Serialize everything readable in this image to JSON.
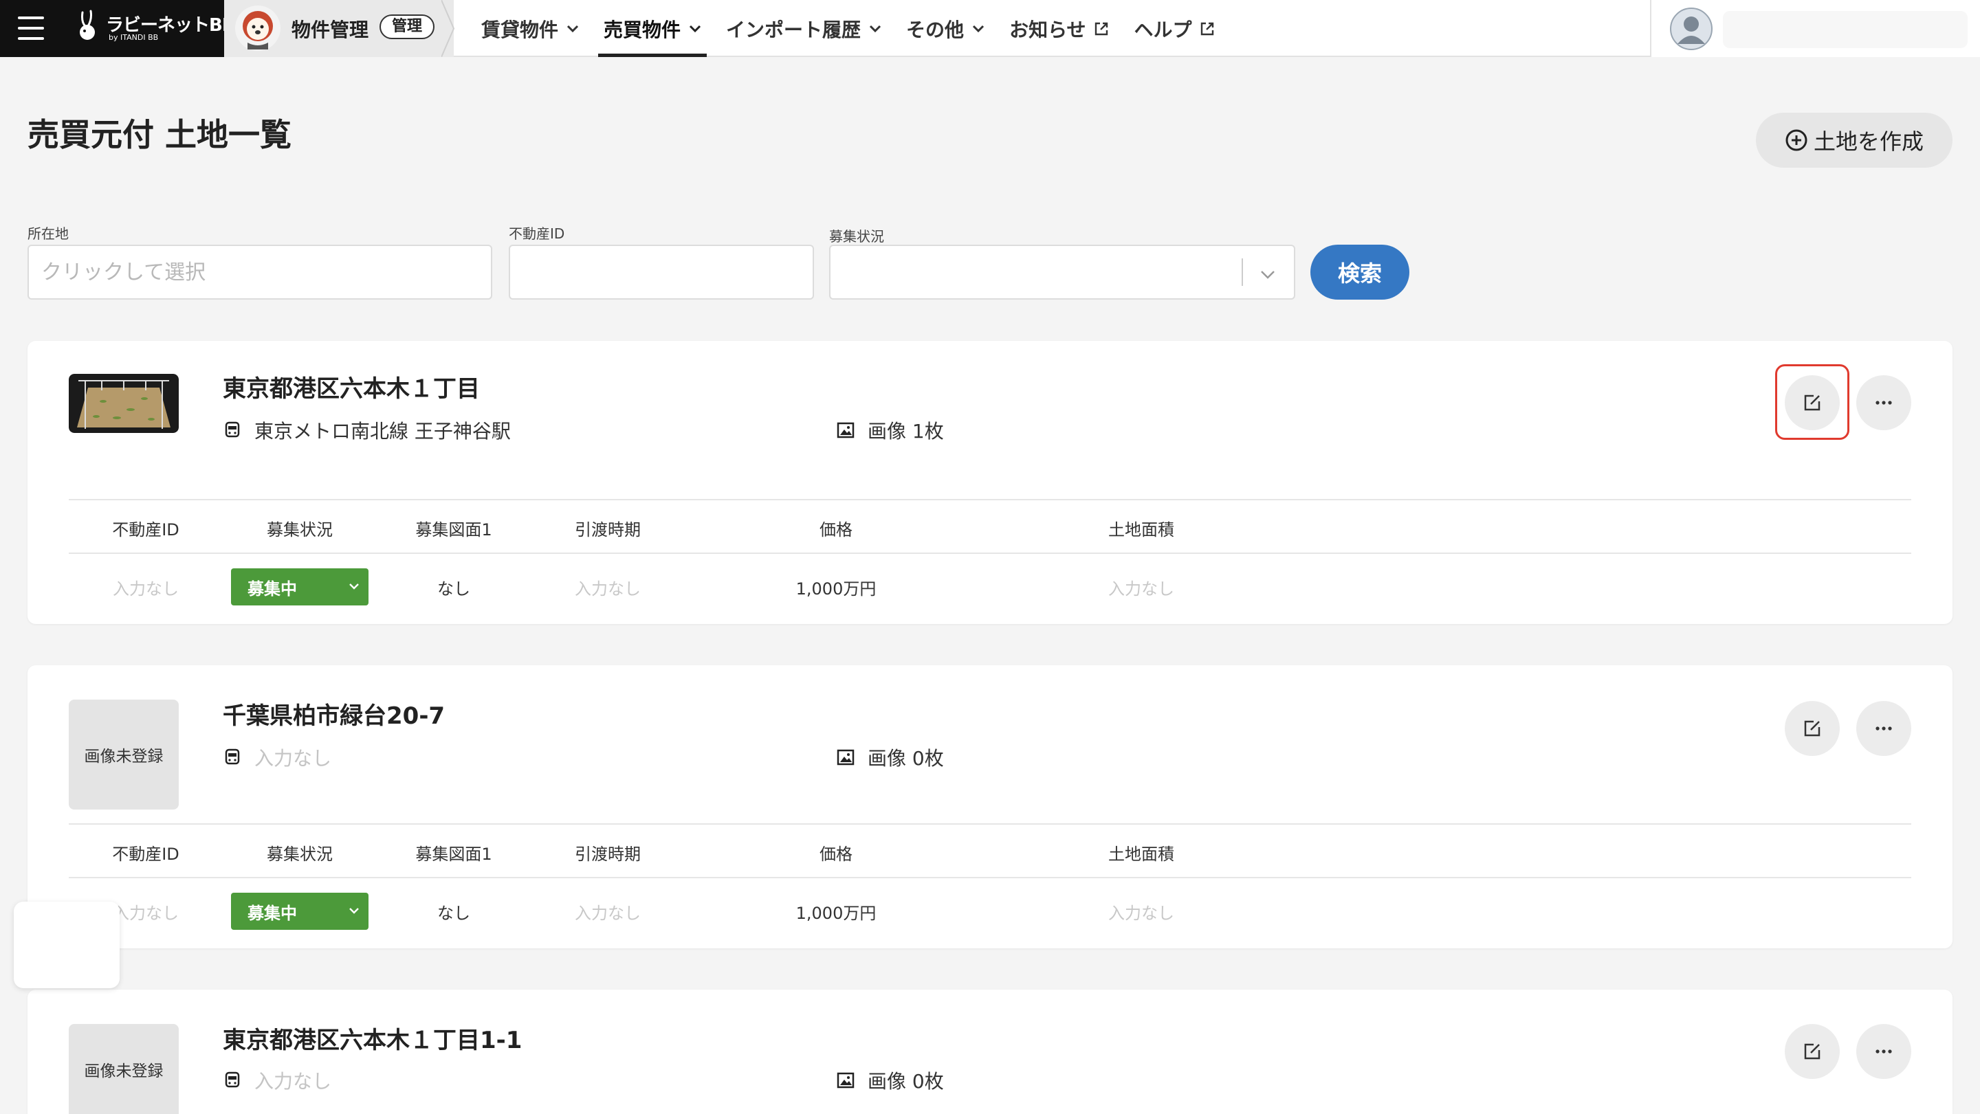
{
  "app": {
    "brand_name": "ラビーネットBB",
    "brand_sub": "by ITANDI BB",
    "module_title": "物件管理",
    "module_badge": "管理"
  },
  "nav": [
    {
      "label": "賃貸物件",
      "type": "dropdown",
      "active": false
    },
    {
      "label": "売買物件",
      "type": "dropdown",
      "active": true
    },
    {
      "label": "インポート履歴",
      "type": "dropdown",
      "active": false
    },
    {
      "label": "その他",
      "type": "dropdown",
      "active": false
    },
    {
      "label": "お知らせ",
      "type": "external",
      "active": false
    },
    {
      "label": "ヘルプ",
      "type": "external",
      "active": false
    }
  ],
  "page": {
    "title": "売買元付 土地一覧",
    "create_button": "土地を作成"
  },
  "filters": {
    "location_label": "所在地",
    "location_placeholder": "クリックして選択",
    "property_id_label": "不動産ID",
    "property_id_value": "",
    "status_label": "募集状況",
    "status_value": "",
    "search_button": "検索"
  },
  "table_headers": [
    "不動産ID",
    "募集状況",
    "募集図面1",
    "引渡時期",
    "価格",
    "土地面積"
  ],
  "properties": [
    {
      "title": "東京都港区六本木１丁目",
      "station": "東京メトロ南北線 王子神谷駅",
      "station_empty": false,
      "images": "画像 1枚",
      "thumbnail": "photo",
      "row": {
        "property_id": "入力なし",
        "status": "募集中",
        "drawing": "なし",
        "delivery": "入力なし",
        "price": "1,000万円",
        "area": "入力なし"
      }
    },
    {
      "title": "千葉県柏市緑台20-7",
      "station": "入力なし",
      "station_empty": true,
      "images": "画像 0枚",
      "thumbnail_label": "画像未登録",
      "row": {
        "property_id": "入力なし",
        "status": "募集中",
        "drawing": "なし",
        "delivery": "入力なし",
        "price": "1,000万円",
        "area": "入力なし"
      }
    },
    {
      "title": "東京都港区六本木１丁目1-1",
      "station": "入力なし",
      "station_empty": true,
      "images": "画像 0枚",
      "thumbnail_label": "画像未登録"
    }
  ],
  "colors": {
    "brand_bg": "#111111",
    "primary": "#3578c4",
    "status_green": "#4c9a3a",
    "highlight": "#e03a2e"
  },
  "icons": {
    "edit": "edit-icon",
    "more": "more-horizontal-icon",
    "station": "train-icon",
    "image": "image-icon",
    "add": "plus-circle-icon",
    "external": "external-link-icon"
  }
}
